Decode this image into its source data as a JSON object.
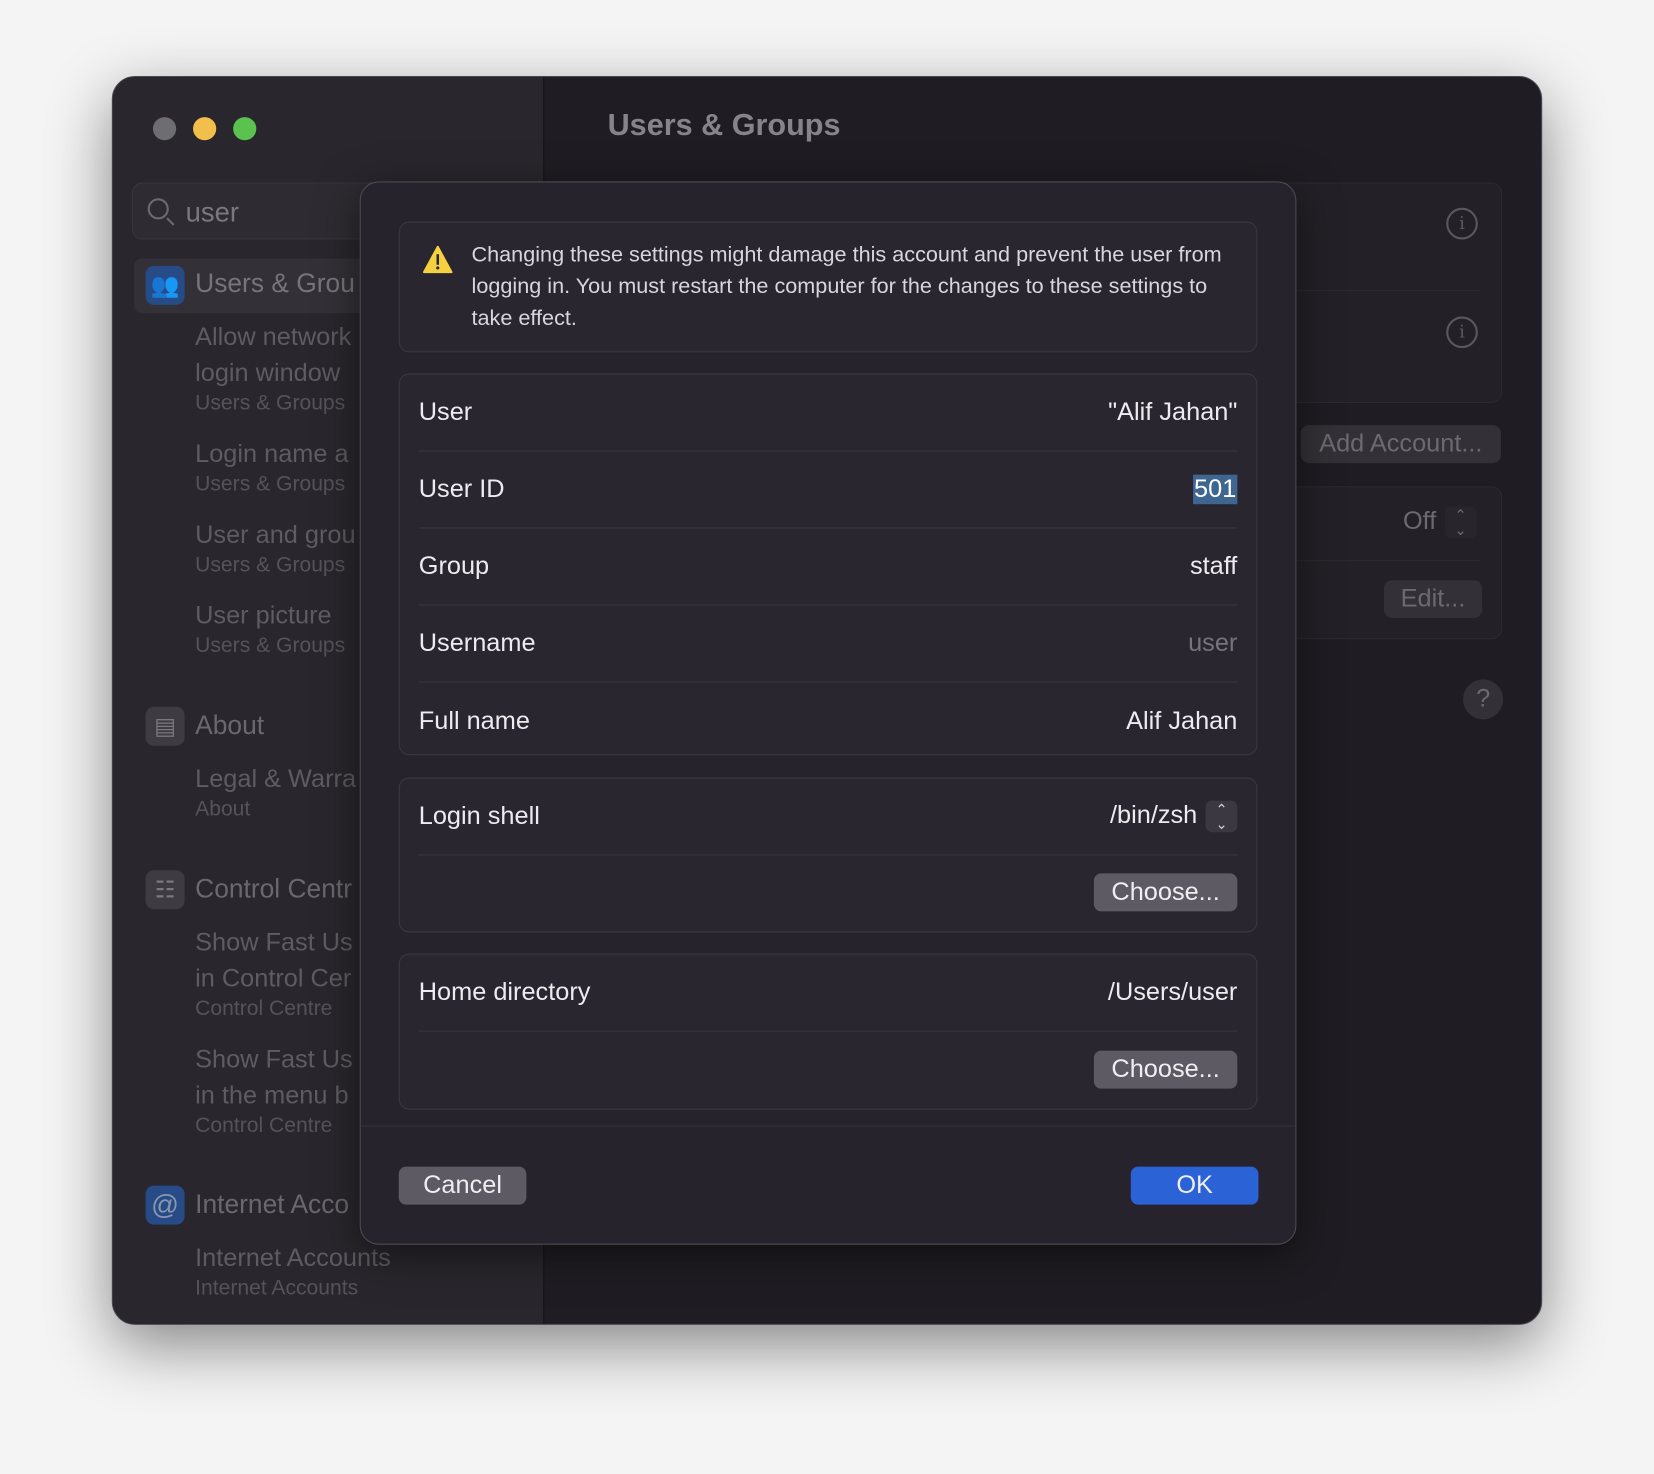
{
  "window": {
    "title": "Users & Groups",
    "traffic_lights": {
      "close": "#6e6d72",
      "minimize": "#f2bf4b",
      "zoom": "#5ac24f"
    }
  },
  "sidebar": {
    "search": {
      "value": "user",
      "icon": "magnifying-glass-icon"
    },
    "sections": [
      {
        "heading": "Users & Grou",
        "icon": "people-icon",
        "icon_color": "#264b86",
        "items": [
          {
            "title": [
              "Allow network",
              "login window"
            ],
            "subtitle": "Users & Groups"
          },
          {
            "title": [
              "Login name a"
            ],
            "subtitle": "Users & Groups"
          },
          {
            "title": [
              "User and grou"
            ],
            "subtitle": "Users & Groups"
          },
          {
            "title": [
              "User picture"
            ],
            "subtitle": "Users & Groups"
          }
        ]
      },
      {
        "heading": "About",
        "icon": "laptop-icon",
        "items": [
          {
            "title": [
              "Legal & Warra"
            ],
            "subtitle": "About"
          }
        ]
      },
      {
        "heading": "Control Centr",
        "icon": "toggles-icon",
        "items": [
          {
            "title": [
              "Show Fast Us",
              "in Control Cer"
            ],
            "subtitle": "Control Centre"
          },
          {
            "title": [
              "Show Fast Us",
              "in the menu b"
            ],
            "subtitle": "Control Centre"
          }
        ]
      },
      {
        "heading": "Internet Acco",
        "icon": "at-sign-icon",
        "icon_color": "#264b86",
        "items": [
          {
            "title": [
              "Internet Accounts"
            ],
            "subtitle": "Internet Accounts"
          }
        ]
      }
    ]
  },
  "main": {
    "add_account": "Add Account...",
    "off_value": "Off",
    "edit": "Edit...",
    "help": "?"
  },
  "dialog": {
    "warning": "Changing these settings might damage this account and prevent the user from logging in. You must restart the computer for the changes to these settings to take effect.",
    "fields": [
      {
        "label": "User",
        "value": "\"Alif Jahan\""
      },
      {
        "label": "User ID",
        "value": "501"
      },
      {
        "label": "Group",
        "value": "staff"
      },
      {
        "label": "Username",
        "value": "user"
      },
      {
        "label": "Full name",
        "value": "Alif Jahan"
      }
    ],
    "login_shell": {
      "label": "Login shell",
      "value": "/bin/zsh",
      "choose": "Choose..."
    },
    "home_directory": {
      "label": "Home directory",
      "value": "/Users/user",
      "choose": "Choose..."
    },
    "cancel": "Cancel",
    "ok": "OK",
    "accent": "#2b62d6"
  }
}
